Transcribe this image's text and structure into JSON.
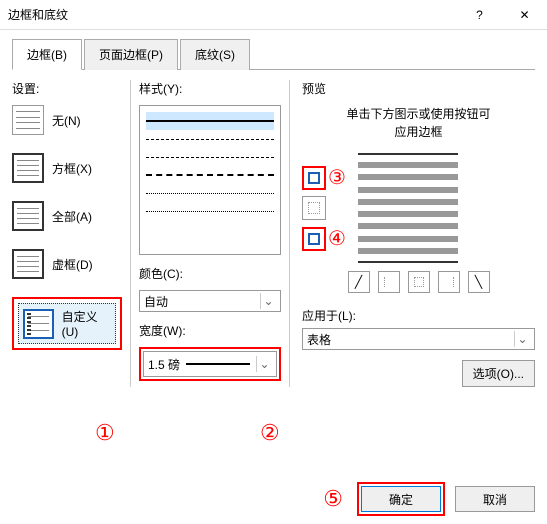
{
  "window": {
    "title": "边框和底纹",
    "help": "?",
    "close": "✕"
  },
  "tabs": {
    "border": "边框(B)",
    "page": "页面边框(P)",
    "shading": "底纹(S)"
  },
  "settings": {
    "label": "设置:",
    "none": "无(N)",
    "box": "方框(X)",
    "all": "全部(A)",
    "grid": "虚框(D)",
    "custom": "自定义(U)"
  },
  "style": {
    "label": "样式(Y):"
  },
  "color": {
    "label": "颜色(C):",
    "value": "自动"
  },
  "width": {
    "label": "宽度(W):",
    "value": "1.5 磅"
  },
  "preview": {
    "label": "预览",
    "hint_line1": "单击下方图示或使用按钮可",
    "hint_line2": "应用边框"
  },
  "apply": {
    "label": "应用于(L):",
    "value": "表格"
  },
  "options": "选项(O)...",
  "footer": {
    "ok": "确定",
    "cancel": "取消"
  },
  "nums": {
    "n1": "①",
    "n2": "②",
    "n3": "③",
    "n4": "④",
    "n5": "⑤"
  }
}
